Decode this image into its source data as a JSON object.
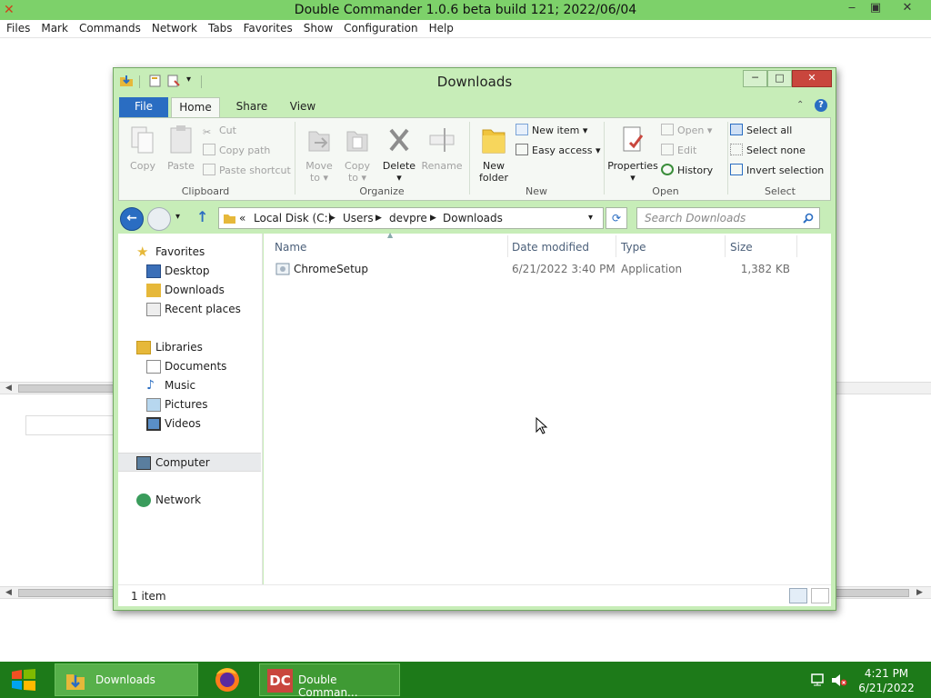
{
  "dc": {
    "title": "Double Commander 1.0.6 beta build 121; 2022/06/04",
    "menu": [
      "Files",
      "Mark",
      "Commands",
      "Network",
      "Tabs",
      "Favorites",
      "Show",
      "Configuration",
      "Help"
    ],
    "buttons": {
      "minimize": "‒",
      "restore": "▣",
      "close": "✕"
    }
  },
  "explorer": {
    "title": "Downloads",
    "tabs": {
      "file": "File",
      "home": "Home",
      "share": "Share",
      "view": "View"
    },
    "ribbon": {
      "clipboard": {
        "label": "Clipboard",
        "copy": "Copy",
        "paste": "Paste",
        "cut": "Cut",
        "copy_path": "Copy path",
        "paste_shortcut": "Paste shortcut"
      },
      "organize": {
        "label": "Organize",
        "move_to": "Move",
        "move_to_2": "to ▾",
        "copy_to": "Copy",
        "copy_to_2": "to ▾",
        "delete": "Delete",
        "delete_2": "▾",
        "rename": "Rename"
      },
      "new": {
        "label": "New",
        "new_folder": "New",
        "new_folder_2": "folder",
        "new_item": "New item ▾",
        "easy_access": "Easy access ▾"
      },
      "open": {
        "label": "Open",
        "properties": "Properties",
        "properties_2": "▾",
        "open": "Open ▾",
        "edit": "Edit",
        "history": "History"
      },
      "select": {
        "label": "Select",
        "select_all": "Select all",
        "select_none": "Select none",
        "invert": "Invert selection"
      }
    },
    "address": {
      "prefix": "«",
      "parts": [
        "Local Disk (C:)",
        "Users",
        "devpre",
        "Downloads"
      ]
    },
    "search_placeholder": "Search Downloads",
    "nav": {
      "favorites": "Favorites",
      "desktop": "Desktop",
      "downloads": "Downloads",
      "recent": "Recent places",
      "libraries": "Libraries",
      "documents": "Documents",
      "music": "Music",
      "pictures": "Pictures",
      "videos": "Videos",
      "computer": "Computer",
      "network": "Network"
    },
    "columns": {
      "name": "Name",
      "date": "Date modified",
      "type": "Type",
      "size": "Size"
    },
    "files": [
      {
        "name": "ChromeSetup",
        "date": "6/21/2022 3:40 PM",
        "type": "Application",
        "size": "1,382 KB"
      }
    ],
    "status": "1 item"
  },
  "taskbar": {
    "items": [
      {
        "label": "Downloads"
      },
      {
        "label": "Double Comman..."
      }
    ],
    "time": "4:21 PM",
    "date": "6/21/2022"
  },
  "colors": {
    "accent": "#7dd16a",
    "taskbar": "#1d7a19",
    "file_tab": "#2a6dc2",
    "close": "#c9463d"
  }
}
